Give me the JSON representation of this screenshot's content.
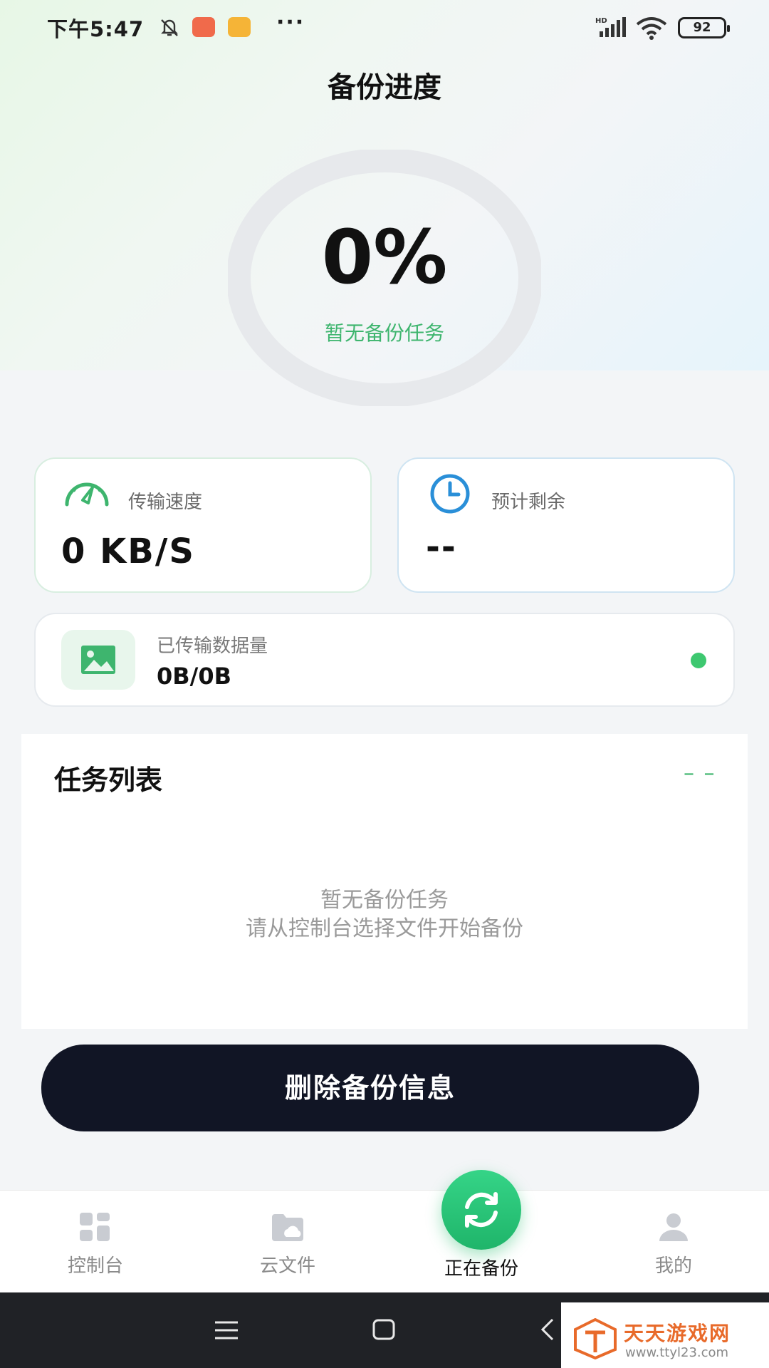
{
  "status_bar": {
    "time": "下午5:47",
    "dots": "···",
    "battery": "92",
    "icons": [
      "bell-muted-icon",
      "app-notification-icon",
      "gallery-notification-icon",
      "hd-signal-icon",
      "wifi-icon",
      "battery-icon"
    ]
  },
  "header": {
    "title": "备份进度"
  },
  "progress": {
    "percent": "0%",
    "status": "暂无备份任务",
    "value": 0
  },
  "stats": {
    "speed": {
      "label": "传输速度",
      "value": "0 KB/S",
      "icon": "speedometer-icon"
    },
    "remaining": {
      "label": "预计剩余",
      "value": "--",
      "icon": "clock-icon"
    }
  },
  "data_transferred": {
    "label": "已传输数据量",
    "value": "0B/0B",
    "icon": "image-icon"
  },
  "task_list": {
    "title": "任务列表",
    "collapse": "– –",
    "empty_title": "暂无备份任务",
    "empty_hint": "请从控制台选择文件开始备份"
  },
  "actions": {
    "delete_label": "删除备份信息"
  },
  "bottom_nav": {
    "items": [
      {
        "label": "控制台",
        "icon": "dashboard-icon",
        "active": false
      },
      {
        "label": "云文件",
        "icon": "cloud-folder-icon",
        "active": false
      },
      {
        "label": "正在备份",
        "icon": "sync-icon",
        "active": true
      },
      {
        "label": "我的",
        "icon": "user-icon",
        "active": false
      }
    ]
  },
  "watermark": {
    "name": "天天游戏网",
    "url": "www.ttyl23.com"
  },
  "colors": {
    "accent_green": "#3eb56e",
    "button_dark": "#111525",
    "clock_blue": "#2a8fd8"
  }
}
